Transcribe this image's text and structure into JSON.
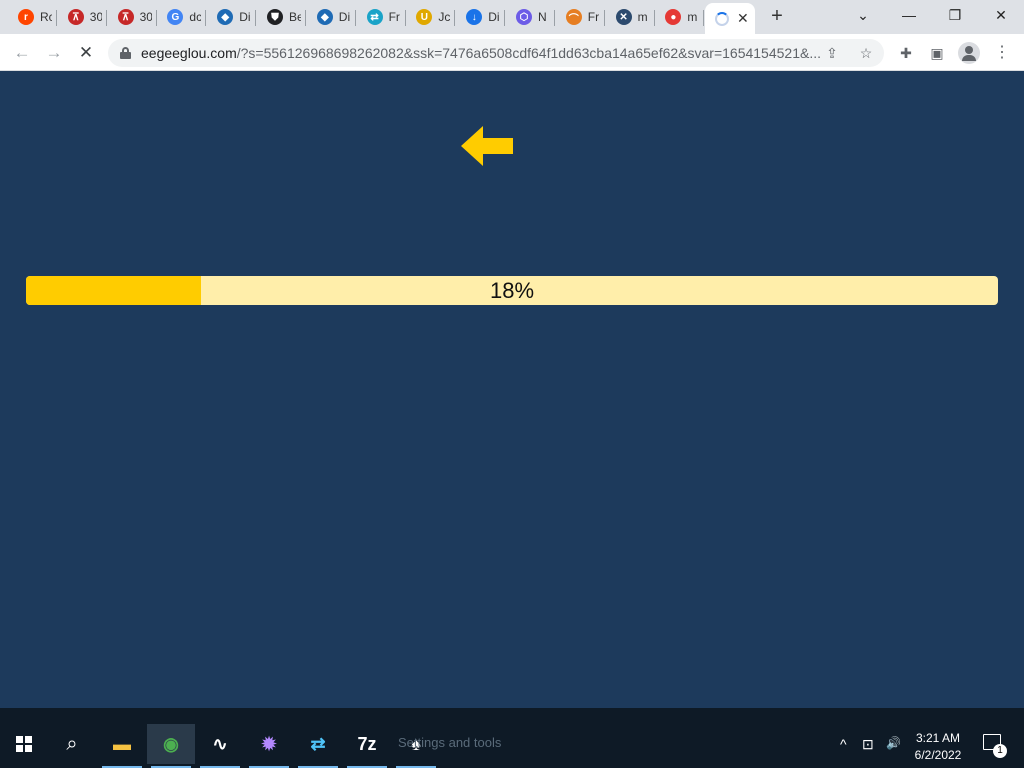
{
  "browser": {
    "tabs": [
      {
        "title": "Rc",
        "icon": "reddit-icon",
        "color": "#ff4500",
        "glyph": "r"
      },
      {
        "title": "30",
        "icon": "chart-icon",
        "color": "#c62828",
        "glyph": "⊼"
      },
      {
        "title": "30",
        "icon": "chart-icon",
        "color": "#c62828",
        "glyph": "⊼"
      },
      {
        "title": "dc",
        "icon": "google-icon",
        "color": "#4285f4",
        "glyph": "G"
      },
      {
        "title": "Di",
        "icon": "diamond-icon",
        "color": "#1f6bb5",
        "glyph": "◆"
      },
      {
        "title": "Be",
        "icon": "shield-icon",
        "color": "#202124",
        "glyph": "⛊"
      },
      {
        "title": "Di",
        "icon": "diamond-icon",
        "color": "#1f6bb5",
        "glyph": "◆"
      },
      {
        "title": "Fr",
        "icon": "transfer-icon",
        "color": "#1aa3c8",
        "glyph": "⇄"
      },
      {
        "title": "Jc",
        "icon": "magnet-icon",
        "color": "#e0a800",
        "glyph": "U"
      },
      {
        "title": "Di",
        "icon": "download-icon",
        "color": "#1a73e8",
        "glyph": "↓"
      },
      {
        "title": "N",
        "icon": "hexagon-icon",
        "color": "#6c5ce7",
        "glyph": "⬡"
      },
      {
        "title": "Fr",
        "icon": "rainbow-icon",
        "color": "#e67e22",
        "glyph": "⌒"
      },
      {
        "title": "m",
        "icon": "tools-icon",
        "color": "#2c4a6e",
        "glyph": "✕"
      },
      {
        "title": "m",
        "icon": "badge-icon",
        "color": "#e53935",
        "glyph": "●"
      }
    ],
    "active_tab": {
      "close": "✕"
    },
    "new_tab": "+",
    "window_controls": {
      "dropdown": "⌄",
      "minimize": "—",
      "restore": "❐",
      "close": "✕"
    },
    "nav": {
      "back": "←",
      "forward": "→",
      "stop": "✕"
    },
    "url_host": "eegeeglou.com",
    "url_rest": "/?s=556126968698262082&ssk=7476a6508cdf64f1dd63cba14a65ef62&svar=1654154521&...",
    "omnibox_icons": {
      "share": "⇪",
      "star": "☆"
    },
    "toolbar_icons": {
      "extensions": "✚",
      "sidepanel": "▣",
      "menu": "⋮"
    }
  },
  "page": {
    "arrow_color": "#ffcc00",
    "progress": {
      "percent": 18,
      "label": "18%"
    }
  },
  "taskbar": {
    "search_icon": "⌕",
    "ghost_text": "Settings and tools",
    "apps": [
      {
        "name": "file-explorer-icon",
        "glyph": "▬",
        "color": "#f5c242",
        "active": false
      },
      {
        "name": "chrome-icon",
        "glyph": "◉",
        "color": "#4caf50",
        "active": true
      },
      {
        "name": "app-wave-icon",
        "glyph": "∿",
        "color": "#ffffff",
        "active": false
      },
      {
        "name": "app-burst-icon",
        "glyph": "✹",
        "color": "#b388ff",
        "active": false
      },
      {
        "name": "app-transfer-icon",
        "glyph": "⇄",
        "color": "#4fc3f7",
        "active": false
      },
      {
        "name": "7zip-icon",
        "glyph": "7z",
        "color": "#ffffff",
        "active": false
      },
      {
        "name": "app-agent-icon",
        "glyph": "♠",
        "color": "#ffffff",
        "active": false
      }
    ],
    "tray": {
      "chevron": "^",
      "network": "⊡",
      "volume": "🔊"
    },
    "time": "3:21 AM",
    "date": "6/2/2022",
    "notifications": "1"
  }
}
